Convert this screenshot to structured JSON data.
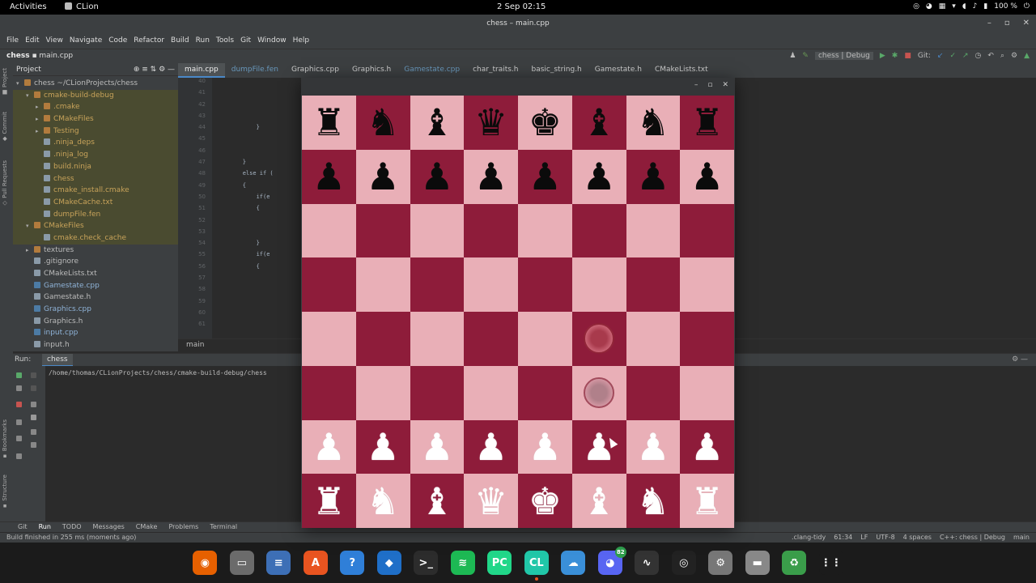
{
  "topbar": {
    "activities": "Activities",
    "app_name": "CLion",
    "clock": "2 Sep  02:15",
    "battery": "100 %"
  },
  "window": {
    "title": "chess – main.cpp",
    "controls": [
      "–",
      "▫",
      "✕"
    ]
  },
  "menu": [
    "File",
    "Edit",
    "View",
    "Navigate",
    "Code",
    "Refactor",
    "Build",
    "Run",
    "Tools",
    "Git",
    "Window",
    "Help"
  ],
  "nav": {
    "project": "chess",
    "file": "main.cpp",
    "config": "chess | Debug",
    "git_label": "Git:"
  },
  "project_panel": {
    "title": "Project",
    "items": [
      {
        "label": "chess  ~/CLionProjects/chess",
        "depth": 0,
        "kind": "folder",
        "arrow": "▾"
      },
      {
        "label": "cmake-build-debug",
        "depth": 1,
        "kind": "folder",
        "arrow": "▾",
        "hl": true
      },
      {
        "label": ".cmake",
        "depth": 2,
        "kind": "folder",
        "arrow": "▸",
        "hl": true
      },
      {
        "label": "CMakeFiles",
        "depth": 2,
        "kind": "folder",
        "arrow": "▸",
        "hl": true
      },
      {
        "label": "Testing",
        "depth": 2,
        "kind": "folder",
        "arrow": "▸",
        "hl": true
      },
      {
        "label": ".ninja_deps",
        "depth": 2,
        "kind": "file",
        "arrow": "",
        "hl": true
      },
      {
        "label": ".ninja_log",
        "depth": 2,
        "kind": "file",
        "arrow": "",
        "hl": true
      },
      {
        "label": "build.ninja",
        "depth": 2,
        "kind": "file",
        "arrow": "",
        "hl": true
      },
      {
        "label": "chess",
        "depth": 2,
        "kind": "file",
        "arrow": "",
        "hl": true
      },
      {
        "label": "cmake_install.cmake",
        "depth": 2,
        "kind": "file",
        "arrow": "",
        "hl": true
      },
      {
        "label": "CMakeCache.txt",
        "depth": 2,
        "kind": "file",
        "arrow": "",
        "hl": true
      },
      {
        "label": "dumpFile.fen",
        "depth": 2,
        "kind": "file",
        "arrow": "",
        "hl": true
      },
      {
        "label": "CMakeFiles",
        "depth": 1,
        "kind": "folder",
        "arrow": "▾",
        "hl": true
      },
      {
        "label": "cmake.check_cache",
        "depth": 2,
        "kind": "file",
        "arrow": "",
        "hl": true
      },
      {
        "label": "textures",
        "depth": 1,
        "kind": "folder",
        "arrow": "▸"
      },
      {
        "label": ".gitignore",
        "depth": 1,
        "kind": "file",
        "arrow": ""
      },
      {
        "label": "CMakeLists.txt",
        "depth": 1,
        "kind": "file",
        "arrow": ""
      },
      {
        "label": "Gamestate.cpp",
        "depth": 1,
        "kind": "cpp",
        "arrow": ""
      },
      {
        "label": "Gamestate.h",
        "depth": 1,
        "kind": "file",
        "arrow": ""
      },
      {
        "label": "Graphics.cpp",
        "depth": 1,
        "kind": "cpp",
        "arrow": ""
      },
      {
        "label": "Graphics.h",
        "depth": 1,
        "kind": "file",
        "arrow": ""
      },
      {
        "label": "input.cpp",
        "depth": 1,
        "kind": "cpp",
        "arrow": ""
      },
      {
        "label": "input.h",
        "depth": 1,
        "kind": "file",
        "arrow": ""
      }
    ]
  },
  "tabs": [
    {
      "label": "main.cpp",
      "active": true
    },
    {
      "label": "dumpFile.fen",
      "mod": true
    },
    {
      "label": "Graphics.cpp"
    },
    {
      "label": "Graphics.h"
    },
    {
      "label": "Gamestate.cpp",
      "mod": true
    },
    {
      "label": "char_traits.h"
    },
    {
      "label": "basic_string.h"
    },
    {
      "label": "Gamestate.h"
    },
    {
      "label": "CMakeLists.txt"
    }
  ],
  "editor": {
    "line_numbers": [
      "40",
      "41",
      "42",
      "43",
      "44",
      "45",
      "46",
      "47",
      "48",
      "49",
      "50",
      "51",
      "52",
      "53",
      "54",
      "55",
      "56",
      "57",
      "58",
      "59",
      "60",
      "61"
    ],
    "lines": [
      "",
      "",
      "",
      "",
      "            }",
      "",
      "",
      "        }",
      "        else if (",
      "        {",
      "            if(e",
      "            {",
      "",
      "",
      "            }",
      "            if(e",
      "            {",
      "",
      "",
      "",
      "",
      ""
    ],
    "breadcrumb": "main"
  },
  "run": {
    "label": "Run:",
    "tab": "chess",
    "output": "/home/thomas/CLionProjects/chess/cmake-build-debug/chess"
  },
  "toolstrip": [
    "Git",
    "Run",
    "TODO",
    "Messages",
    "CMake",
    "Problems",
    "Terminal"
  ],
  "status": {
    "left": "Build finished in 255 ms (moments ago)",
    "right": [
      ".clang-tidy",
      "61:34",
      "LF",
      "UTF-8",
      "4 spaces",
      "C++: chess | Debug",
      "main"
    ]
  },
  "chess": {
    "colors": {
      "light": "#e9afb7",
      "dark": "#8e1c3a"
    },
    "board": [
      [
        "r",
        "n",
        "b",
        "q",
        "k",
        "b",
        "n",
        "r"
      ],
      [
        "p",
        "p",
        "p",
        "p",
        "p",
        "p",
        "p",
        "p"
      ],
      [
        "",
        "",
        "",
        "",
        "",
        "",
        "",
        ""
      ],
      [
        "",
        "",
        "",
        "",
        "",
        "",
        "",
        ""
      ],
      [
        "",
        "",
        "",
        "",
        "",
        "*",
        "",
        ""
      ],
      [
        "",
        "",
        "",
        "",
        "",
        "o",
        "",
        ""
      ],
      [
        "P",
        "P",
        "P",
        "P",
        "P",
        "P",
        "P",
        "P"
      ],
      [
        "R",
        "N",
        "B",
        "Q",
        "K",
        "B",
        "N",
        "R"
      ]
    ]
  },
  "dock": [
    {
      "name": "firefox-icon",
      "bg": "#e66000",
      "glyph": "◉"
    },
    {
      "name": "files-icon",
      "bg": "#6b6b6b",
      "glyph": "▭"
    },
    {
      "name": "text-editor-icon",
      "bg": "#3d6fb6",
      "glyph": "≡"
    },
    {
      "name": "software-center-icon",
      "bg": "#e95420",
      "glyph": "A"
    },
    {
      "name": "help-icon",
      "bg": "#2f7fd8",
      "glyph": "?"
    },
    {
      "name": "vscode-icon",
      "bg": "#1f6fc8",
      "glyph": "◆"
    },
    {
      "name": "terminal-icon",
      "bg": "#2c2c2c",
      "glyph": ">_"
    },
    {
      "name": "spotify-icon",
      "bg": "#1db954",
      "glyph": "≋"
    },
    {
      "name": "pycharm-icon",
      "bg": "#21d789",
      "glyph": "PC"
    },
    {
      "name": "clion-icon",
      "bg": "#21c7a8",
      "glyph": "CL",
      "active": true
    },
    {
      "name": "cloud-icon",
      "bg": "#3a8fd8",
      "glyph": "☁"
    },
    {
      "name": "discord-icon",
      "bg": "#5865f2",
      "glyph": "◕",
      "badge": "82"
    },
    {
      "name": "system-monitor-icon",
      "bg": "#333",
      "glyph": "∿"
    },
    {
      "name": "unity-icon",
      "bg": "#222",
      "glyph": "◎"
    },
    {
      "name": "settings-icon",
      "bg": "#777",
      "glyph": "⚙"
    },
    {
      "name": "drive-icon",
      "bg": "#888",
      "glyph": "▬"
    },
    {
      "name": "trash-icon",
      "bg": "#3a9d4a",
      "glyph": "♻"
    },
    {
      "name": "app-grid-icon",
      "bg": "#1b1b1b",
      "glyph": "⋮⋮"
    }
  ]
}
